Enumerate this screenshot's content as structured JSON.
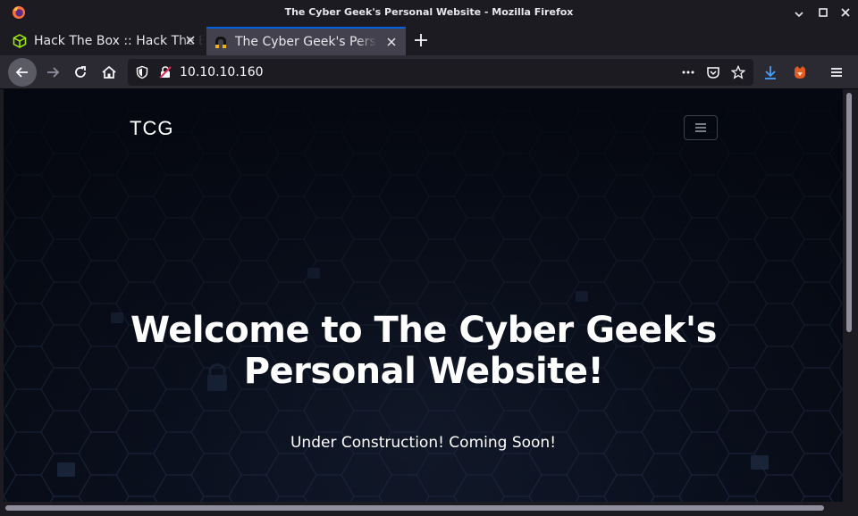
{
  "window": {
    "title": "The Cyber Geek's Personal Website - Mozilla Firefox"
  },
  "tabs": [
    {
      "label": "Hack The Box :: Hack The Box",
      "active": false,
      "icon": "hackthebox-cube-icon"
    },
    {
      "label": "The Cyber Geek's Personal Website",
      "active": true,
      "icon": "cyber-geek-favicon-icon"
    }
  ],
  "navbar": {
    "url": "10.10.10.160"
  },
  "page": {
    "brand": "TCG",
    "hero_title_line1": "Welcome to The Cyber Geek's",
    "hero_title_line2": "Personal Website!",
    "hero_subtitle": "Under Construction! Coming Soon!"
  },
  "colors": {
    "chrome_dark": "#1c1b22",
    "toolbar": "#2b2a33",
    "active_tab": "#42414d",
    "accent_blue": "#0060df",
    "download_blue": "#45a1ff"
  }
}
